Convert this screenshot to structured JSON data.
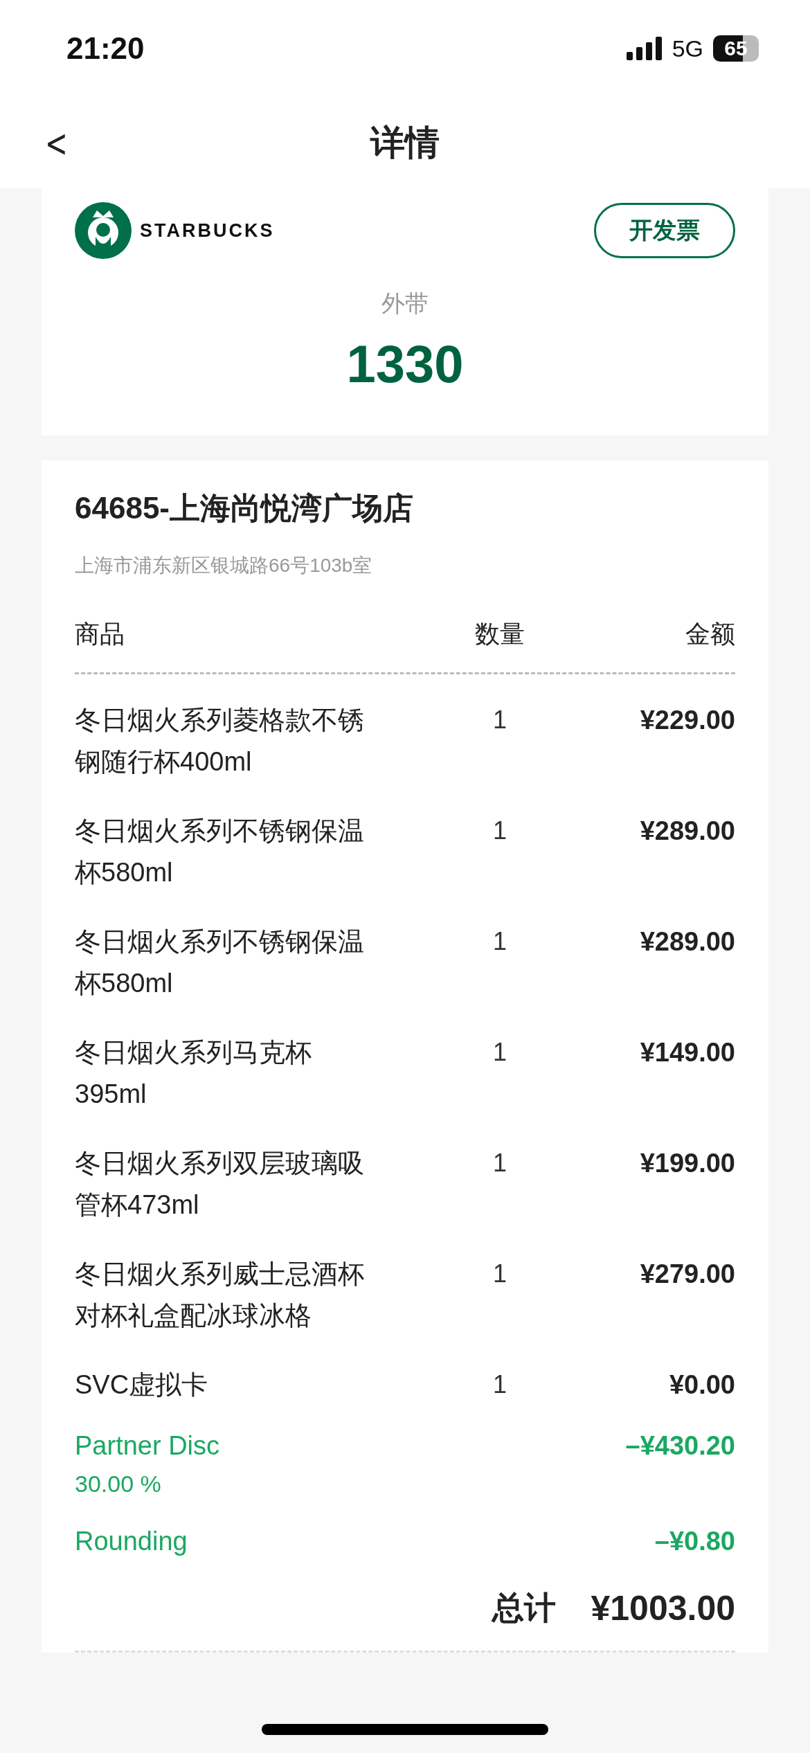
{
  "status_bar": {
    "time": "21:20",
    "network": "5G",
    "battery": "65"
  },
  "header": {
    "back": "<",
    "title": "详情"
  },
  "summary": {
    "brand": "STARBUCKS",
    "invoice_button": "开发票",
    "order_type": "外带",
    "order_number": "1330"
  },
  "store": {
    "name": "64685-上海尚悦湾广场店",
    "address": "上海市浦东新区银城路66号103b室"
  },
  "table": {
    "columns": [
      "商品",
      "数量",
      "金额"
    ],
    "rows": [
      {
        "kind": "product",
        "name": "冬日烟火系列菱格款不锈钢随行杯400ml",
        "qty": "1",
        "amount": "¥229.00"
      },
      {
        "kind": "product",
        "name": "冬日烟火系列不锈钢保温杯580ml",
        "qty": "1",
        "amount": "¥289.00"
      },
      {
        "kind": "product",
        "name": "冬日烟火系列不锈钢保温杯580ml",
        "qty": "1",
        "amount": "¥289.00"
      },
      {
        "kind": "product",
        "name": "冬日烟火系列马克杯395ml",
        "qty": "1",
        "amount": "¥149.00"
      },
      {
        "kind": "product",
        "name": "冬日烟火系列双层玻璃吸管杯473ml",
        "qty": "1",
        "amount": "¥199.00"
      },
      {
        "kind": "product",
        "name": "冬日烟火系列威士忌酒杯对杯礼盒配冰球冰格",
        "qty": "1",
        "amount": "¥279.00"
      },
      {
        "kind": "product",
        "name": "SVC虚拟卡",
        "qty": "1",
        "amount": "¥0.00"
      },
      {
        "kind": "discount",
        "name": "Partner Disc",
        "note": "30.00 %",
        "amount": "–¥430.20"
      },
      {
        "kind": "discount",
        "name": "Rounding",
        "amount": "–¥0.80"
      }
    ]
  },
  "total": {
    "label": "总计",
    "amount": "¥1003.00"
  }
}
